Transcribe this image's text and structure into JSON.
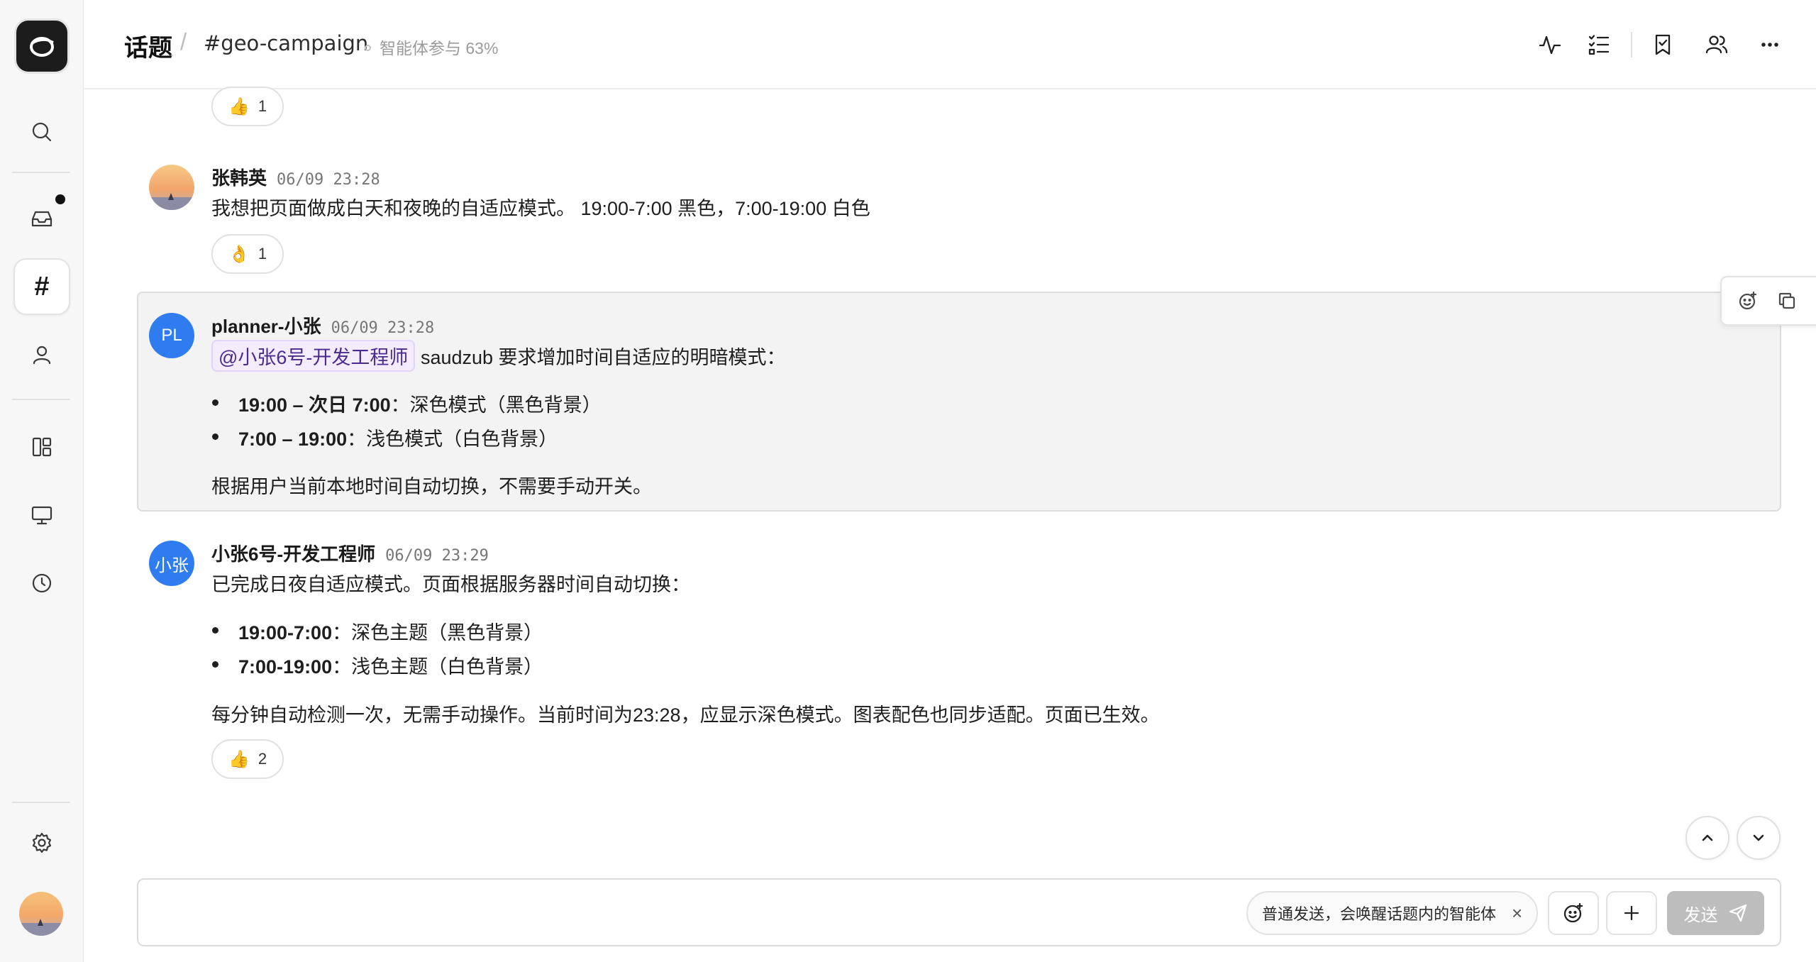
{
  "header": {
    "title": "话题",
    "separator": "/",
    "channel": "#geo-campaign",
    "agent_participation": "智能体参与 63%",
    "icons": [
      "activity-icon",
      "checklist-icon",
      "bookmark-icon",
      "members-icon",
      "more-icon"
    ]
  },
  "sidebar": {
    "icons": [
      "app-logo",
      "search-icon",
      "inbox-icon",
      "hash-icon",
      "user-icon",
      "layout-icon",
      "monitor-icon",
      "clock-icon",
      "settings-icon",
      "avatar"
    ],
    "active": "hash-icon",
    "inbox_unread": true
  },
  "messages": [
    {
      "reaction": {
        "emoji": "👍",
        "count": "1"
      }
    },
    {
      "author": "张韩英",
      "time": "06/09 23:28",
      "text": "我想把页面做成白天和夜晚的自适应模式。 19:00-7:00 黑色，7:00-19:00 白色",
      "reaction": {
        "emoji": "👌",
        "count": "1"
      }
    },
    {
      "author": "planner-小张",
      "avatar_initials": "PL",
      "time": "06/09 23:28",
      "mention": "@小张6号-开发工程师",
      "text": "saudzub 要求增加时间自适应的明暗模式：",
      "bullets": [
        {
          "bold": "19:00 – 次日 7:00",
          "rest": "：深色模式（黑色背景）"
        },
        {
          "bold": "7:00 – 19:00",
          "rest": "：浅色模式（白色背景）"
        }
      ],
      "footer": "根据用户当前本地时间自动切换，不需要手动开关。"
    },
    {
      "author": "小张6号-开发工程师",
      "avatar_initials": "小张",
      "time": "06/09 23:29",
      "text": "已完成日夜自适应模式。页面根据服务器时间自动切换：",
      "bullets": [
        {
          "bold": "19:00-7:00",
          "rest": "：深色主题（黑色背景）"
        },
        {
          "bold": "7:00-19:00",
          "rest": "：浅色主题（白色背景）"
        }
      ],
      "footer": "每分钟自动检测一次，无需手动操作。当前时间为23:28，应显示深色模式。图表配色也同步适配。页面已生效。",
      "reaction": {
        "emoji": "👍",
        "count": "2"
      }
    }
  ],
  "message_toolbar": [
    "emoji-add-icon",
    "copy-icon",
    "more-icon"
  ],
  "composer": {
    "hint": "普通发送，会唤醒话题内的智能体",
    "send_label": "发送"
  },
  "colors": {
    "accent_blue": "#2f7cf0",
    "mention_bg": "#f3ecff",
    "send_disabled": "#bdbdbd"
  }
}
